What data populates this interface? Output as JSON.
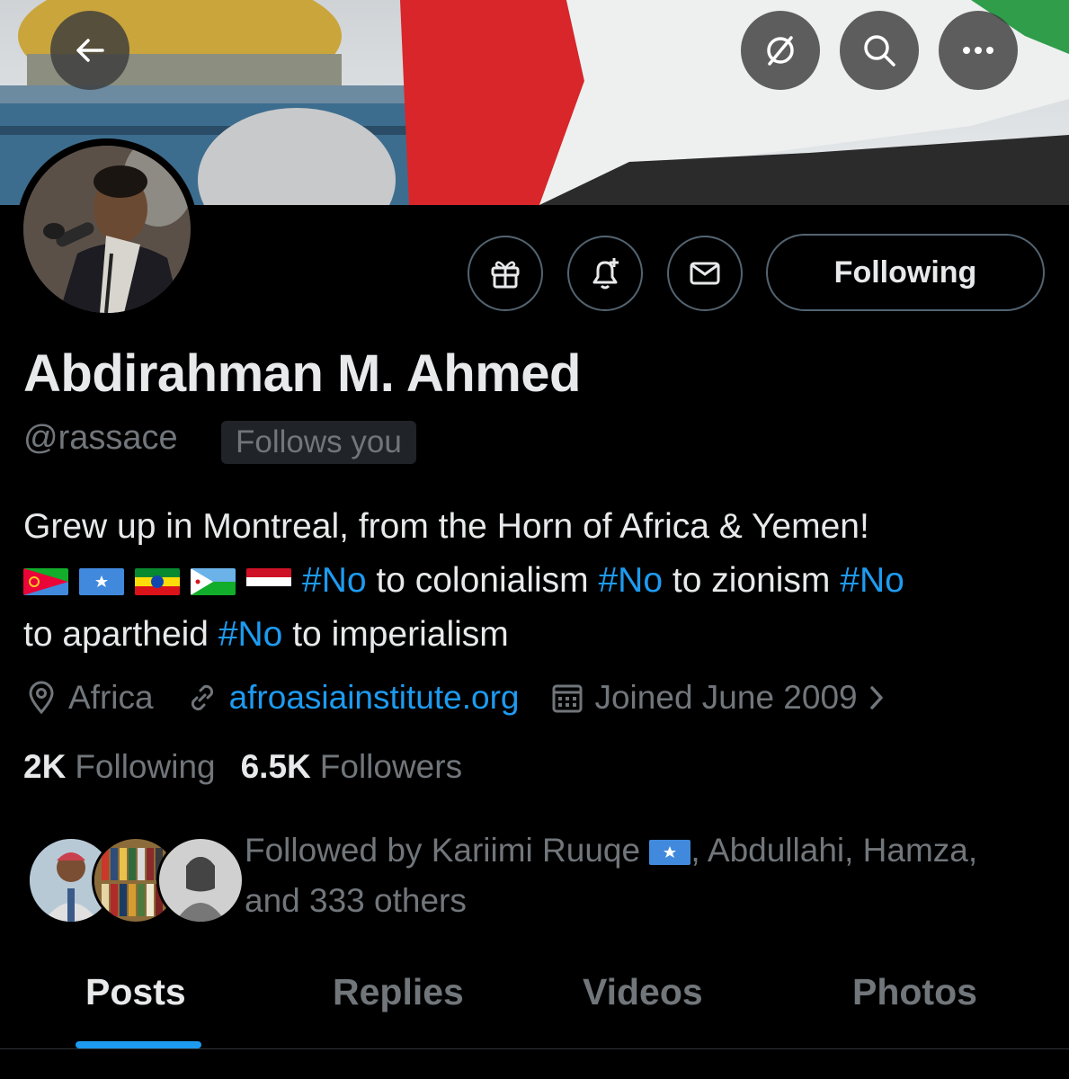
{
  "nav": {
    "back_icon": "arrow-left-icon",
    "grok_icon": "slashed-circle-icon",
    "search_icon": "search-icon",
    "more_icon": "more-icon"
  },
  "profile": {
    "name": "Abdirahman M. Ahmed",
    "handle": "@rassace",
    "follows_you": "Follows you",
    "following_button": "Following",
    "bio_line1": "Grew up in Montreal, from the Horn of Africa & Yemen!",
    "bio_segments": [
      {
        "text": "#No",
        "hashtag": true
      },
      {
        "text": " to colonialism ",
        "hashtag": false
      },
      {
        "text": "#No",
        "hashtag": true
      },
      {
        "text": " to zionism ",
        "hashtag": false
      },
      {
        "text": "#No",
        "hashtag": true
      },
      {
        "text": " to apartheid ",
        "hashtag": false
      },
      {
        "text": "#No",
        "hashtag": true
      },
      {
        "text": " to imperialism",
        "hashtag": false
      }
    ],
    "location": "Africa",
    "website": "afroasiainstitute.org",
    "joined": "Joined June 2009",
    "following_count": "2K",
    "following_label": "Following",
    "followers_count": "6.5K",
    "followers_label": "Followers",
    "followed_by_prefix": "Followed by Kariimi Ruuqe",
    "followed_by_suffix": ", Abdullahi, Hamza,",
    "followed_by_line2": "and 333 others"
  },
  "tabs": [
    {
      "label": "Posts",
      "active": true
    },
    {
      "label": "Replies",
      "active": false
    },
    {
      "label": "Videos",
      "active": false
    },
    {
      "label": "Photos",
      "active": false
    }
  ],
  "colors": {
    "accent": "#1d9bf0",
    "muted": "#71767b",
    "background": "#000000"
  }
}
